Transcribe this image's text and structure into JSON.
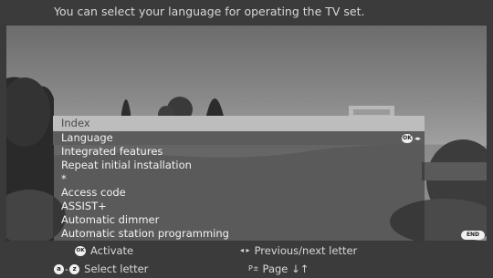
{
  "header": {
    "info_text": "You can select your language for operating the TV set."
  },
  "menu": {
    "title": "Index",
    "items": [
      {
        "label": "Language"
      },
      {
        "label": "Integrated features"
      },
      {
        "label": "Repeat initial installation"
      },
      {
        "label": "*"
      },
      {
        "label": "Access code"
      },
      {
        "label": "ASSIST+"
      },
      {
        "label": "Automatic dimmer"
      },
      {
        "label": "Automatic station programming"
      }
    ],
    "selected_hint": {
      "ok_label": "OK",
      "arrows": "◂▸"
    }
  },
  "end_button": {
    "label": "END"
  },
  "help": {
    "ok_badge": "OK",
    "activate": "Activate",
    "arrows_symbol": "◂ ▸",
    "prev_next": "Previous/next letter",
    "letter_a": "a",
    "dash": "-",
    "letter_z": "z",
    "select_letter": "Select letter",
    "page_symbol": "P±",
    "page": "Page ↓↑"
  }
}
